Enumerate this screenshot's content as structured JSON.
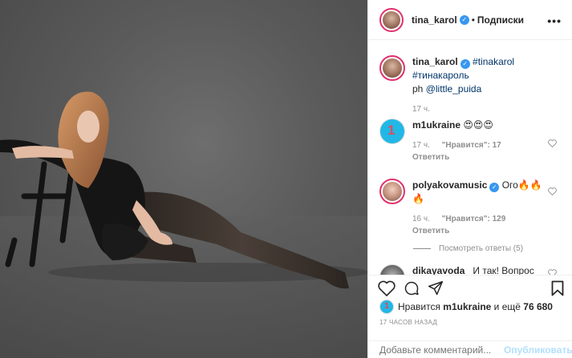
{
  "post": {
    "author": "tina_karol",
    "follow_dot": "•",
    "follow_label": "Подписки",
    "more_label": "•••"
  },
  "caption": {
    "username": "tina_karol",
    "hashtags": "#tinakarol #тинакароль",
    "credit_prefix": "ph",
    "credit_handle": "@little_puida",
    "time": "17 ч."
  },
  "comments": [
    {
      "username": "m1ukraine",
      "text": "😍😍😍",
      "time": "17 ч.",
      "likes": "\"Нравится\": 17",
      "reply": "Ответить",
      "verified": false
    },
    {
      "username": "polyakovamusic",
      "text": "Ого🔥🔥🔥",
      "time": "16 ч.",
      "likes": "\"Нравится\": 129",
      "reply": "Ответить",
      "verified": true
    },
    {
      "username": "dikayavoda_",
      "text": "И так! Вопрос Тине Кароль!!! Уважаемая Тина Григорьевна, будет ли исполнятся песня",
      "verified": false
    }
  ],
  "view_replies": "Посмотреть ответы (5)",
  "likes": {
    "prefix": "Нравится",
    "user": "m1ukraine",
    "middle": "и ещё",
    "count": "76 680"
  },
  "timestamp": "17 ЧАСОВ НАЗАД",
  "comment_box": {
    "placeholder": "Добавьте комментарий...",
    "publish_label": "Опубликовать"
  },
  "colors": {
    "link": "#003569",
    "publish_disabled": "#b2dffc",
    "story_ring": "#e1306c",
    "verified": "#3897f0"
  }
}
